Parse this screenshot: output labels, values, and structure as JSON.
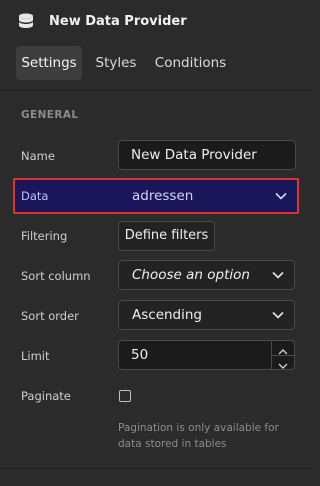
{
  "header": {
    "title": "New Data Provider",
    "icon": "database-icon"
  },
  "tabs": [
    {
      "label": "Settings",
      "active": true
    },
    {
      "label": "Styles",
      "active": false
    },
    {
      "label": "Conditions",
      "active": false
    }
  ],
  "section": {
    "general": "GENERAL"
  },
  "fields": {
    "name": {
      "label": "Name",
      "value": "New Data Provider"
    },
    "data": {
      "label": "Data",
      "value": "adressen"
    },
    "filtering": {
      "label": "Filtering",
      "button": "Define filters"
    },
    "sort_column": {
      "label": "Sort column",
      "placeholder": "Choose an option"
    },
    "sort_order": {
      "label": "Sort order",
      "value": "Ascending"
    },
    "limit": {
      "label": "Limit",
      "value": "50"
    },
    "paginate": {
      "label": "Paginate",
      "checked": false,
      "help": "Pagination is only available for data stored in tables"
    }
  },
  "colors": {
    "background": "#2b2b2b",
    "highlight_border": "#e0302f",
    "highlight_fill": "#1a1659"
  }
}
